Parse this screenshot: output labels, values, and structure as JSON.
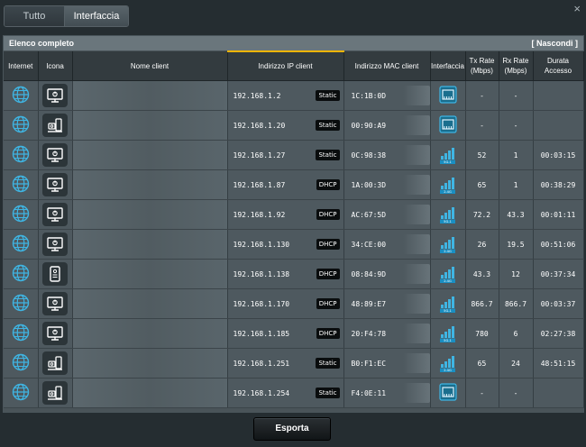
{
  "tabs": [
    {
      "label": "Tutto",
      "active": false
    },
    {
      "label": "Interfaccia",
      "active": true
    }
  ],
  "close_label": "×",
  "panel": {
    "title": "Elenco completo",
    "hide_label": "[ Nascondi ]"
  },
  "columns": {
    "internet": "Internet",
    "icona": "Icona",
    "name": "Nome client",
    "ip": "Indirizzo IP client",
    "mac": "Indirizzo MAC client",
    "iface": "Interfaccia",
    "tx": "Tx Rate (Mbps)",
    "rx": "Rx Rate (Mbps)",
    "dur": "Durata Accesso"
  },
  "clients": [
    {
      "device": "desktop",
      "ip": "192.168.1.2",
      "type": "Static",
      "mac": "1C:1B:0D",
      "iface": "ethernet",
      "tx": "-",
      "rx": "-",
      "dur": ""
    },
    {
      "device": "nas",
      "ip": "192.168.1.20",
      "type": "Static",
      "mac": "00:90:A9",
      "iface": "ethernet",
      "tx": "-",
      "rx": "-",
      "dur": ""
    },
    {
      "device": "desktop",
      "ip": "192.168.1.27",
      "type": "Static",
      "mac": "0C:98:38",
      "iface": "wifi",
      "band": "5G-1",
      "tx": "52",
      "rx": "1",
      "dur": "00:03:15"
    },
    {
      "device": "desktop",
      "ip": "192.168.1.87",
      "type": "DHCP",
      "mac": "1A:00:3D",
      "iface": "wifi",
      "band": "2.4G",
      "tx": "65",
      "rx": "1",
      "dur": "00:38:29"
    },
    {
      "device": "desktop",
      "ip": "192.168.1.92",
      "type": "DHCP",
      "mac": "AC:67:5D",
      "iface": "wifi",
      "band": "5G-1",
      "tx": "72.2",
      "rx": "43.3",
      "dur": "00:01:11"
    },
    {
      "device": "desktop",
      "ip": "192.168.1.130",
      "type": "DHCP",
      "mac": "34:CE:00",
      "iface": "wifi",
      "band": "2.4G",
      "tx": "26",
      "rx": "19.5",
      "dur": "00:51:06"
    },
    {
      "device": "phone",
      "ip": "192.168.1.138",
      "type": "DHCP",
      "mac": "08:84:9D",
      "iface": "wifi",
      "band": "2.4G",
      "tx": "43.3",
      "rx": "12",
      "dur": "00:37:34"
    },
    {
      "device": "desktop",
      "ip": "192.168.1.170",
      "type": "DHCP",
      "mac": "48:89:E7",
      "iface": "wifi",
      "band": "5G-1",
      "tx": "866.7",
      "rx": "866.7",
      "dur": "00:03:37"
    },
    {
      "device": "desktop",
      "ip": "192.168.1.185",
      "type": "DHCP",
      "mac": "20:F4:78",
      "iface": "wifi",
      "band": "5G-1",
      "tx": "780",
      "rx": "6",
      "dur": "02:27:38"
    },
    {
      "device": "nas",
      "ip": "192.168.1.251",
      "type": "Static",
      "mac": "B0:F1:EC",
      "iface": "wifi",
      "band": "2.4G",
      "tx": "65",
      "rx": "24",
      "dur": "48:51:15"
    },
    {
      "device": "nas",
      "ip": "192.168.1.254",
      "type": "Static",
      "mac": "F4:0E:11",
      "iface": "ethernet",
      "tx": "-",
      "rx": "-",
      "dur": ""
    }
  ],
  "export_label": "Esporta",
  "colors": {
    "accent": "#f0b400",
    "icon_blue": "#3fb5e3",
    "bg": "#252d31"
  }
}
